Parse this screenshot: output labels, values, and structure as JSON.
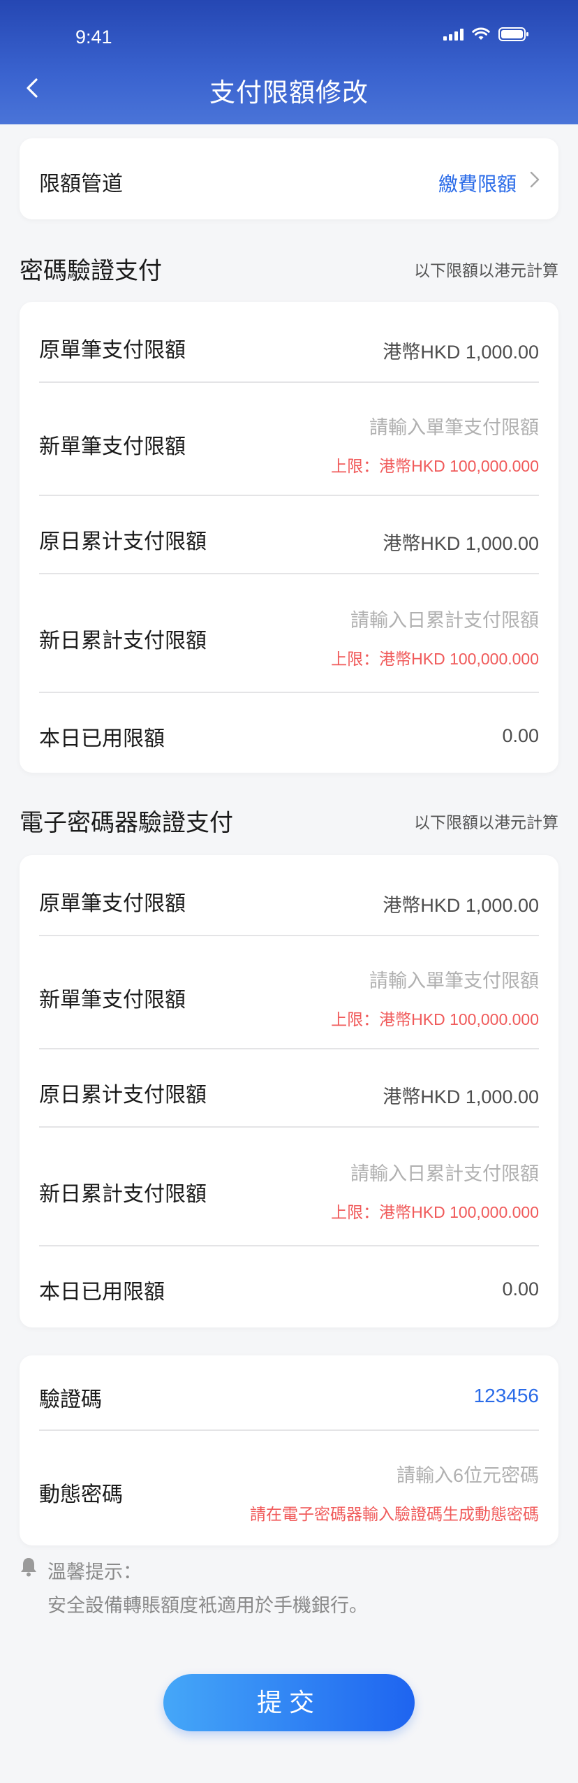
{
  "status": {
    "time": "9:41"
  },
  "header": {
    "title": "支付限額修改"
  },
  "channel": {
    "label": "限額管道",
    "value": "繳費限額"
  },
  "password_section": {
    "title": "密碼驗證支付",
    "note": "以下限額以港元計算",
    "rows": {
      "orig_single": {
        "label": "原單筆支付限額",
        "value": "港幣HKD  1,000.00"
      },
      "new_single": {
        "label": "新單筆支付限額",
        "placeholder": "請輸入單筆支付限額",
        "limit": "上限：港幣HKD 100,000.000"
      },
      "orig_daily": {
        "label": "原日累计支付限額",
        "value": "港幣HKD  1,000.00"
      },
      "new_daily": {
        "label": "新日累計支付限額",
        "placeholder": "請輸入日累計支付限額",
        "limit": "上限：港幣HKD 100,000.000"
      },
      "used_today": {
        "label": "本日已用限額",
        "value": "0.00"
      }
    }
  },
  "token_section": {
    "title": "電子密碼器驗證支付",
    "note": "以下限額以港元計算",
    "rows": {
      "orig_single": {
        "label": "原單筆支付限額",
        "value": "港幣HKD  1,000.00"
      },
      "new_single": {
        "label": "新單筆支付限額",
        "placeholder": "請輸入單筆支付限額",
        "limit": "上限：港幣HKD 100,000.000"
      },
      "orig_daily": {
        "label": "原日累计支付限額",
        "value": "港幣HKD  1,000.00"
      },
      "new_daily": {
        "label": "新日累計支付限額",
        "placeholder": "請輸入日累計支付限額",
        "limit": "上限：港幣HKD 100,000.000"
      },
      "used_today": {
        "label": "本日已用限額",
        "value": "0.00"
      }
    }
  },
  "verify": {
    "code_label": "驗證碼",
    "code_value": "123456",
    "dynamic_label": "動態密碼",
    "dynamic_placeholder": "請輸入6位元密碼",
    "dynamic_hint": "請在電子密碼器輸入驗證碼生成動態密碼"
  },
  "tip": {
    "title": "溫馨提示：",
    "body": "安全設備轉賬額度衹適用於手機銀行。"
  },
  "submit_label": "提交",
  "colors": {
    "header": "#3a63cf",
    "accent": "#2a6be8",
    "warning": "#f05a5a"
  },
  "icons": [
    "back-arrow-icon",
    "signal-icon",
    "wifi-icon",
    "battery-icon",
    "chevron-right-icon",
    "bell-icon"
  ]
}
